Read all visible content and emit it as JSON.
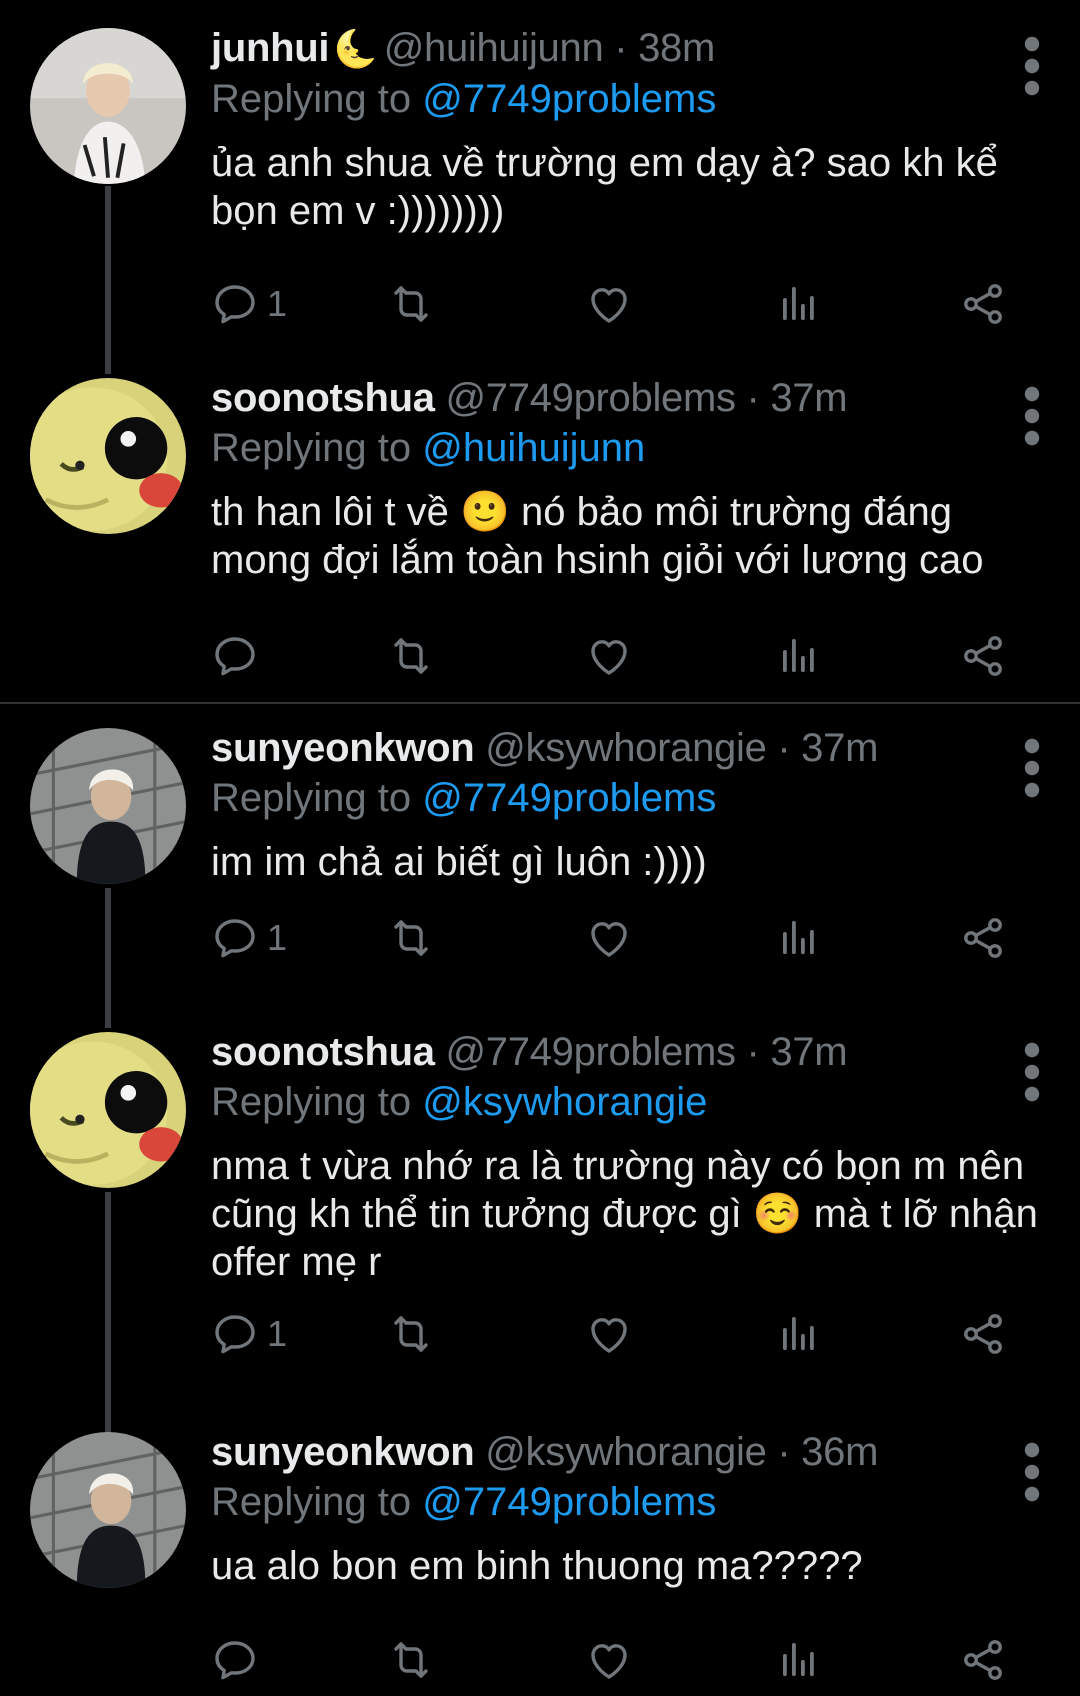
{
  "colors": {
    "background": "#000000",
    "text": "#e7e9ea",
    "muted": "#71767b",
    "mention": "#1d9bf0",
    "thread_line": "#3a3d42"
  },
  "icons": {
    "reply": "reply-icon",
    "retweet": "retweet-icon",
    "like": "heart-icon",
    "views": "views-icon",
    "share": "share-icon",
    "more": "more-icon"
  },
  "tweets": [
    {
      "name": "junhui",
      "name_emoji": "🌜",
      "handle": "@huihuijunn",
      "time": "38m",
      "replying_label": "Replying to",
      "replying_to": "@7749problems",
      "text": "ủa anh shua về trường em dạy à? sao kh kể bọn em v :))))))))",
      "reply_count": "1"
    },
    {
      "name": "soonotshua",
      "handle": "@7749problems",
      "time": "37m",
      "replying_label": "Replying to",
      "replying_to": "@huihuijunn",
      "text": "th han lôi t về 🙂 nó bảo môi trường đáng mong đợi lắm toàn hsinh giỏi với lương cao",
      "reply_count": ""
    },
    {
      "name": "sunyeonkwon",
      "handle": "@ksywhorangie",
      "time": "37m",
      "replying_label": "Replying to",
      "replying_to": "@7749problems",
      "text": "im im chả ai biết gì luôn :))))",
      "reply_count": "1"
    },
    {
      "name": "soonotshua",
      "handle": "@7749problems",
      "time": "37m",
      "replying_label": "Replying to",
      "replying_to": "@ksywhorangie",
      "text": "nma t vừa nhớ ra là trường này có bọn m nên cũng kh thể tin tưởng được gì ☺️ mà t lỡ nhận offer mẹ r",
      "reply_count": "1"
    },
    {
      "name": "sunyeonkwon",
      "handle": "@ksywhorangie",
      "time": "36m",
      "replying_label": "Replying to",
      "replying_to": "@7749problems",
      "text": "ua alo bon em binh thuong ma?????",
      "reply_count": ""
    }
  ]
}
